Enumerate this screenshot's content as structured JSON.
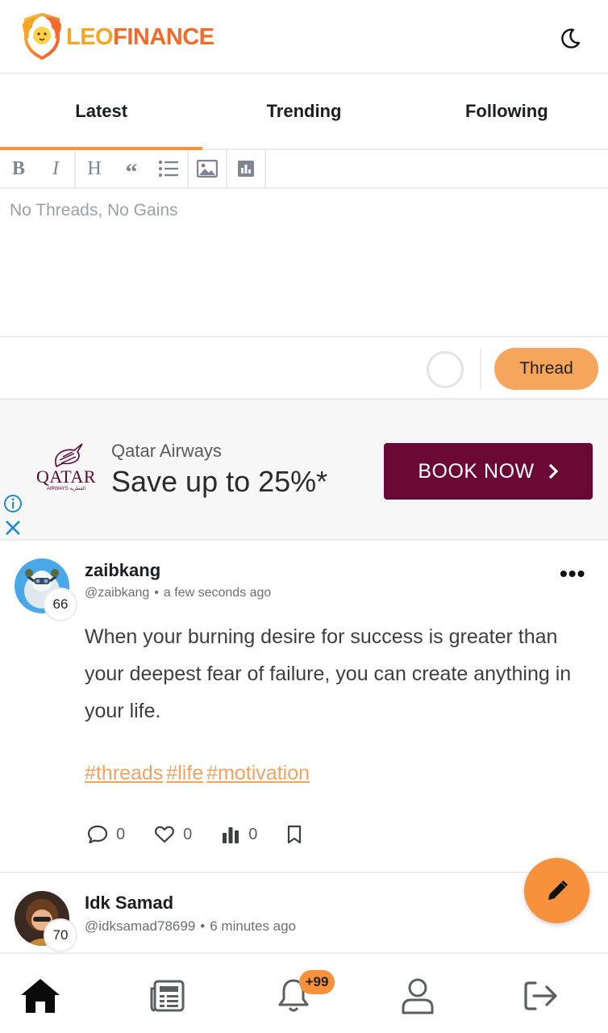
{
  "app": {
    "logo_leo": "LEO",
    "logo_finance": "FINANCE",
    "theme_icon": "moon-icon",
    "brand_color": "#f7913b"
  },
  "tabs": [
    {
      "label": "Latest",
      "active": true
    },
    {
      "label": "Trending",
      "active": false
    },
    {
      "label": "Following",
      "active": false
    }
  ],
  "editor": {
    "toolbar": [
      "bold-icon",
      "italic-icon",
      "heading-icon",
      "quote-icon",
      "list-icon",
      "image-icon",
      "poll-icon"
    ],
    "bold": "B",
    "italic": "I",
    "heading": "H",
    "quote": "“",
    "placeholder": "No Threads, No Gains",
    "submit_label": "Thread"
  },
  "ad": {
    "logo_text": "QATAR",
    "logo_sub": "AIRWAYS القطرية",
    "brand": "Qatar Airways",
    "headline": "Save up to 25%*",
    "cta": "BOOK NOW",
    "cta_color": "#6b0734"
  },
  "posts": [
    {
      "author": "zaibkang",
      "handle": "@zaibkang",
      "time": "a few seconds ago",
      "reputation": "66",
      "body": "When your burning desire for success is greater than your deepest fear of failure, you can create anything in your life.",
      "tags": [
        "#threads",
        "#life",
        "#motivation"
      ],
      "comments": "0",
      "likes": "0",
      "votes": "0"
    },
    {
      "author": "Idk Samad",
      "handle": "@idksamad78699",
      "time": "6 minutes ago",
      "reputation": "70"
    }
  ],
  "nav": {
    "items": [
      "home-icon",
      "news-icon",
      "bell-icon",
      "user-icon",
      "logout-icon"
    ],
    "notifications_badge": "+99"
  }
}
